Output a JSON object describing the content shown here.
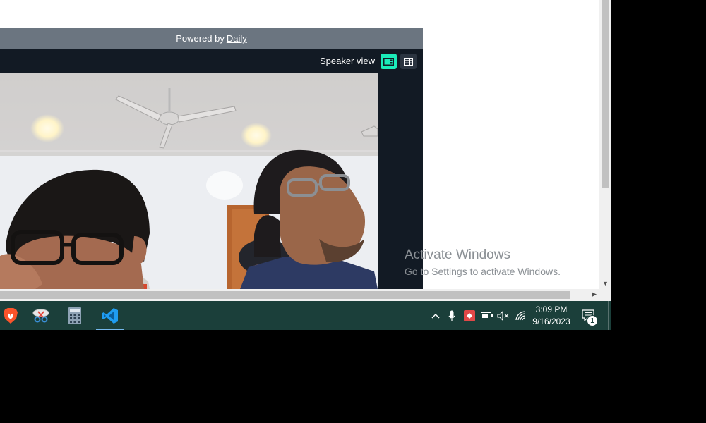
{
  "call": {
    "powered_by_prefix": "Powered by",
    "powered_by_brand": "Daily",
    "view_label": "Speaker view",
    "speaker_view_icon": "speaker-view-icon",
    "grid_view_icon": "grid-view-icon",
    "accent_color": "#1bebb9"
  },
  "watermark": {
    "title": "Activate Windows",
    "subtitle": "Go to Settings to activate Windows."
  },
  "taskbar": {
    "apps": [
      {
        "name": "brave-browser",
        "icon": "brave-lion-icon"
      },
      {
        "name": "snipping-tool",
        "icon": "scissors-icon"
      },
      {
        "name": "calculator",
        "icon": "calculator-icon"
      },
      {
        "name": "visual-studio-code",
        "icon": "vscode-icon",
        "active": true
      }
    ],
    "tray": [
      "chevron-up-icon",
      "microphone-icon",
      "screen-record-icon",
      "battery-icon",
      "speaker-muted-icon",
      "wifi-icon"
    ],
    "time": "3:09 PM",
    "date": "9/16/2023",
    "notification_count": "1"
  }
}
